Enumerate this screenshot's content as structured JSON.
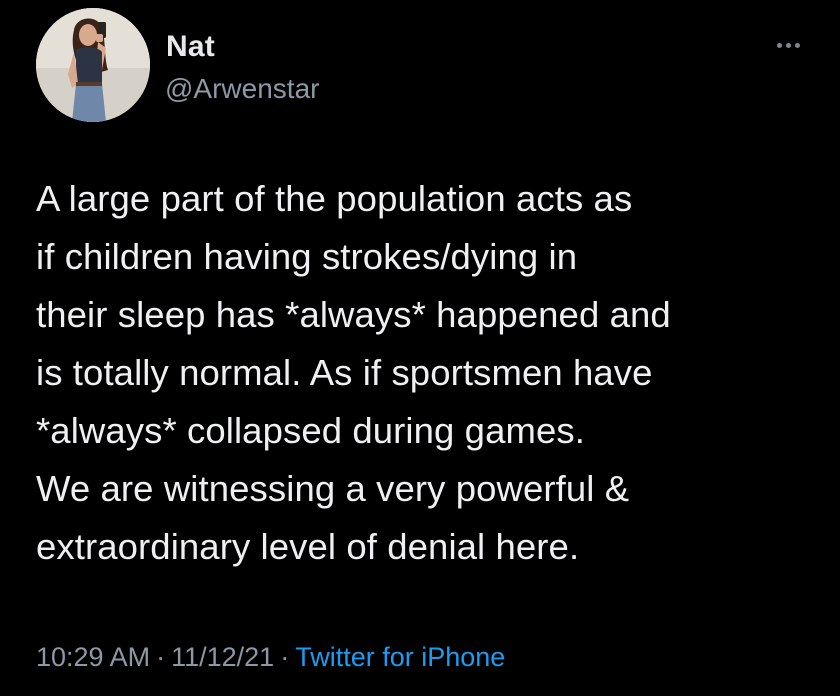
{
  "tweet": {
    "display_name": "Nat",
    "handle": "@Arwenstar",
    "more_icon": "more-horizontal-icon",
    "text_lines": [
      "A large part of the population acts as",
      "if children having strokes/dying in",
      "their sleep has *always* happened and",
      "is totally normal. As if sportsmen have",
      "*always* collapsed during games.",
      "We are witnessing a very powerful &",
      "extraordinary level of denial here."
    ],
    "time": "10:29 AM",
    "date": "11/12/21",
    "separator": "·",
    "source": "Twitter for iPhone"
  },
  "colors": {
    "background": "#000000",
    "text": "#e7e9ea",
    "secondary": "#8b98a5",
    "link": "#1d9bf0"
  }
}
